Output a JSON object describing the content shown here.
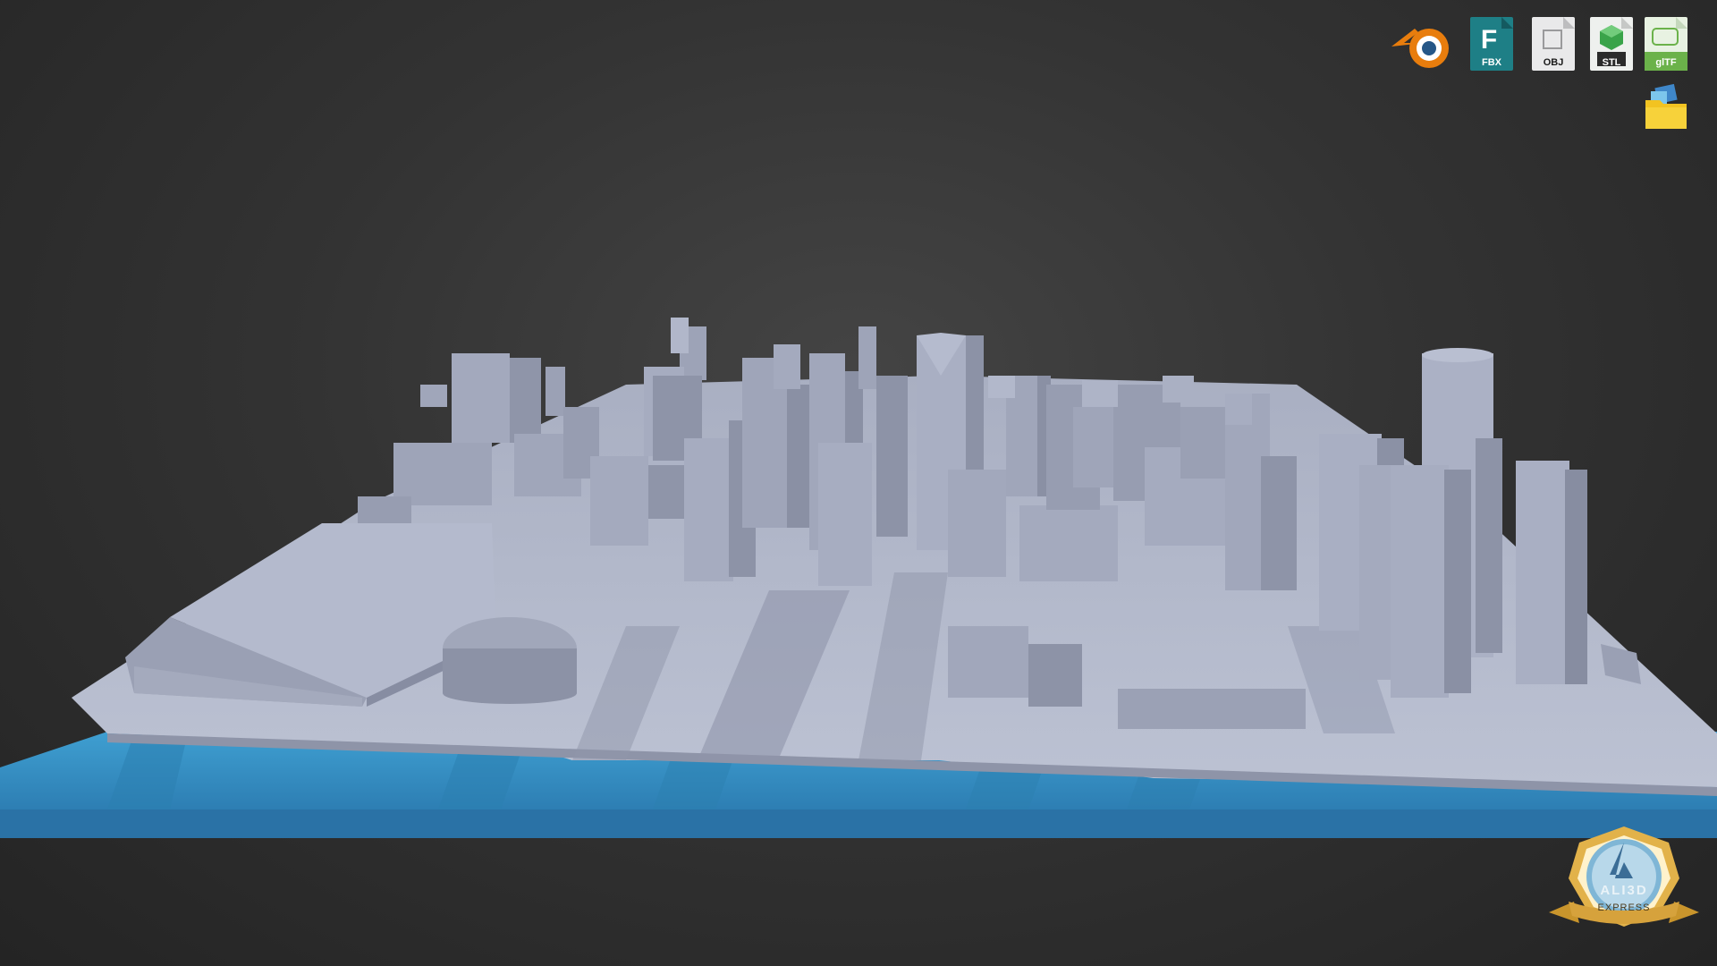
{
  "viewport": {
    "background": "#333333",
    "scene": "3D city model render",
    "colors": {
      "buildings": "#a7adbf",
      "water": "#3a9ccc",
      "ground": "#b6bccd"
    }
  },
  "export_formats": [
    {
      "name": "Blender",
      "label": "",
      "icon": "blender-icon"
    },
    {
      "name": "FBX",
      "label": "FBX",
      "icon": "fbx-file-icon"
    },
    {
      "name": "OBJ",
      "label": "OBJ",
      "icon": "obj-file-icon"
    },
    {
      "name": "STL",
      "label": "STL",
      "icon": "stl-file-icon"
    },
    {
      "name": "glTF",
      "label": "glTF",
      "icon": "gltf-file-icon"
    }
  ],
  "textures_folder": {
    "icon": "folder-icon"
  },
  "badge": {
    "brand": "ALI3D",
    "subtitle": "EXPRESS",
    "colors": {
      "rim": "#e2b24a",
      "core": "#7fb6d6"
    }
  }
}
